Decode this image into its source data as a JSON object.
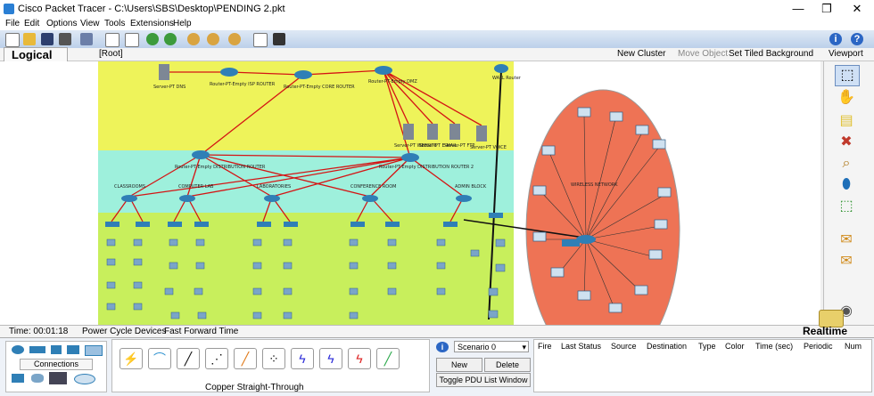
{
  "window": {
    "title": "Cisco Packet Tracer - C:\\Users\\SBS\\Desktop\\PENDING 2.pkt",
    "minimize": "—",
    "maximize": "❐",
    "close": "✕"
  },
  "menu": [
    "File",
    "Edit",
    "Options",
    "View",
    "Tools",
    "Extensions",
    "Help"
  ],
  "workspace": {
    "tab": "Logical",
    "root": "[Root]",
    "new_cluster": "New Cluster",
    "move_object": "Move Object",
    "set_bg": "Set Tiled Background",
    "viewport": "Viewport"
  },
  "canvas": {
    "colors": {
      "top_zone": "#eef35a",
      "mid_zone": "#9ef0dc",
      "low_zone": "#c8ef5c",
      "cloud": "#ee7355",
      "link": "#d41414"
    },
    "devices": {
      "dns": "Server-PT DNS",
      "isp": "Router-PT-Empty ISP ROUTER",
      "core": "Router-PT-Empty CORE ROUTER",
      "dmz": "Router-PT-Empty DMZ",
      "wall": "WALL Router",
      "srv_website": "Server-PT WEBSITE",
      "srv_email": "Server-PT E-MAIL",
      "srv_ftp": "Server-PT FTP",
      "srv_voice": "Server-PT VOICE",
      "dist1": "Router-PT-Empty DISTRIBUTION ROUTER",
      "dist2": "Router-PT-Empty DISTRIBUTION ROUTER 2",
      "classrooms": "CLASSROOMS",
      "computer_lab": "COMPUTER LAB",
      "laboratories": "LABORATORIES",
      "conference": "CONFERENCE ROOM",
      "admin_block": "ADMIN BLOCK",
      "wireless": "WIRELESS NETWORK"
    }
  },
  "palette_icons": [
    "select-icon",
    "hand-icon",
    "note-icon",
    "delete-icon",
    "inspect-icon",
    "draw-shape-icon",
    "resize-icon",
    "add-simple-pdu-icon",
    "add-complex-pdu-icon"
  ],
  "status": {
    "time": "Time: 00:01:18",
    "power_cycle": "Power Cycle Devices",
    "fast_forward": "Fast Forward Time",
    "realtime": "Realtime"
  },
  "bottom": {
    "connections": "Connections",
    "connection_caption": "Copper Straight-Through",
    "scenario": "Scenario 0",
    "new": "New",
    "delete": "Delete",
    "toggle_pdu": "Toggle PDU List Window",
    "columns": [
      "Fire",
      "Last Status",
      "Source",
      "Destination",
      "Type",
      "Color",
      "Time (sec)",
      "Periodic",
      "Num"
    ]
  }
}
